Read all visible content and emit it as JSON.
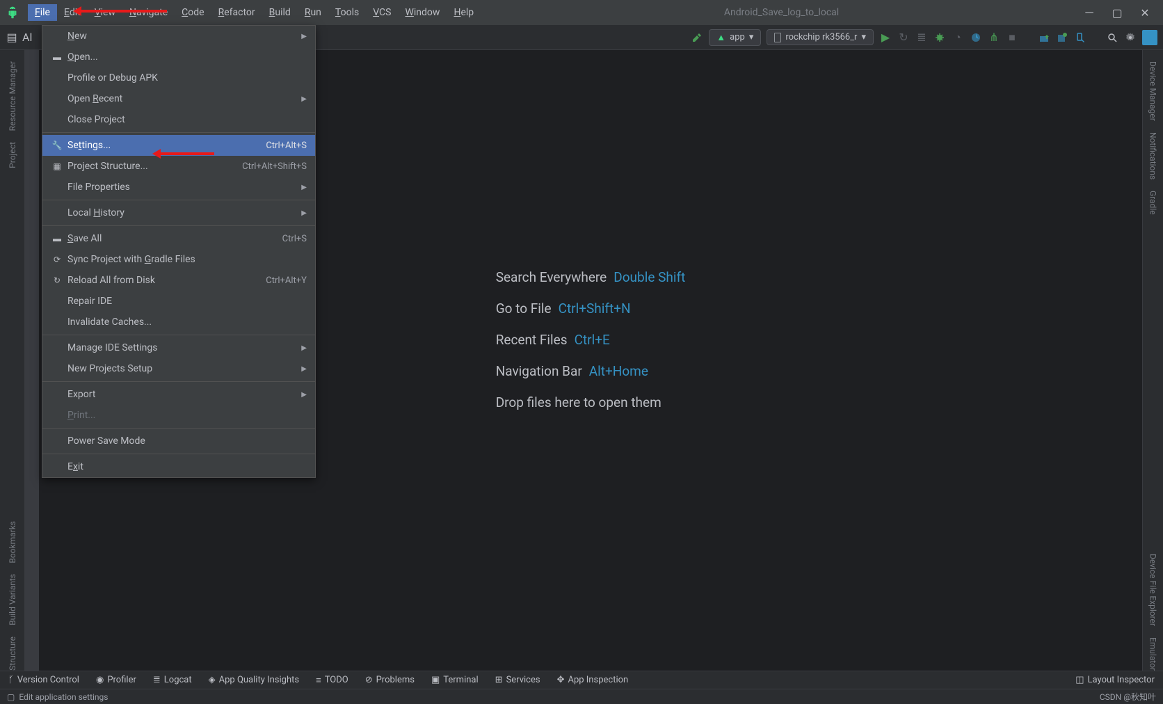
{
  "title": "Android_Save_log_to_local",
  "menubar": [
    "File",
    "Edit",
    "View",
    "Navigate",
    "Code",
    "Refactor",
    "Build",
    "Run",
    "Tools",
    "VCS",
    "Window",
    "Help"
  ],
  "toolbar": {
    "breadcrumb": "Al",
    "config": "app",
    "device": "rockchip rk3566_r"
  },
  "file_menu": [
    {
      "label": "New",
      "arrow": true,
      "mn": 0
    },
    {
      "label": "Open...",
      "icon": "folder",
      "mn": 0
    },
    {
      "label": "Profile or Debug APK"
    },
    {
      "label": "Open Recent",
      "arrow": true,
      "mn": 5
    },
    {
      "label": "Close Project"
    },
    "---",
    {
      "label": "Settings...",
      "shortcut": "Ctrl+Alt+S",
      "icon": "wrench",
      "selected": true,
      "mn": 2
    },
    {
      "label": "Project Structure...",
      "shortcut": "Ctrl+Alt+Shift+S",
      "icon": "structure"
    },
    {
      "label": "File Properties",
      "arrow": true
    },
    "---",
    {
      "label": "Local History",
      "arrow": true,
      "mn": 6
    },
    "---",
    {
      "label": "Save All",
      "shortcut": "Ctrl+S",
      "icon": "save",
      "mn": 0
    },
    {
      "label": "Sync Project with Gradle Files",
      "icon": "sync",
      "mn": 18
    },
    {
      "label": "Reload All from Disk",
      "shortcut": "Ctrl+Alt+Y",
      "icon": "reload"
    },
    {
      "label": "Repair IDE"
    },
    {
      "label": "Invalidate Caches..."
    },
    "---",
    {
      "label": "Manage IDE Settings",
      "arrow": true
    },
    {
      "label": "New Projects Setup",
      "arrow": true
    },
    "---",
    {
      "label": "Export",
      "arrow": true
    },
    {
      "label": "Print...",
      "disabled": true,
      "mn": 0
    },
    "---",
    {
      "label": "Power Save Mode"
    },
    "---",
    {
      "label": "Exit",
      "mn": 1
    }
  ],
  "welcome": [
    {
      "label": "Search Everywhere",
      "shortcut": "Double Shift"
    },
    {
      "label": "Go to File",
      "shortcut": "Ctrl+Shift+N"
    },
    {
      "label": "Recent Files",
      "shortcut": "Ctrl+E"
    },
    {
      "label": "Navigation Bar",
      "shortcut": "Alt+Home"
    },
    {
      "label": "Drop files here to open them",
      "shortcut": ""
    }
  ],
  "left_tools": [
    "Resource Manager",
    "Project",
    "Bookmarks",
    "Build Variants",
    "Structure"
  ],
  "right_tools": [
    "Device Manager",
    "Notifications",
    "Gradle",
    "Device File Explorer",
    "Emulator"
  ],
  "bottom_tools": [
    "Version Control",
    "Profiler",
    "Logcat",
    "App Quality Insights",
    "TODO",
    "Problems",
    "Terminal",
    "Services",
    "App Inspection"
  ],
  "bottom_right": "Layout Inspector",
  "status": {
    "left": "Edit application settings",
    "right": "CSDN @秋知叶"
  }
}
